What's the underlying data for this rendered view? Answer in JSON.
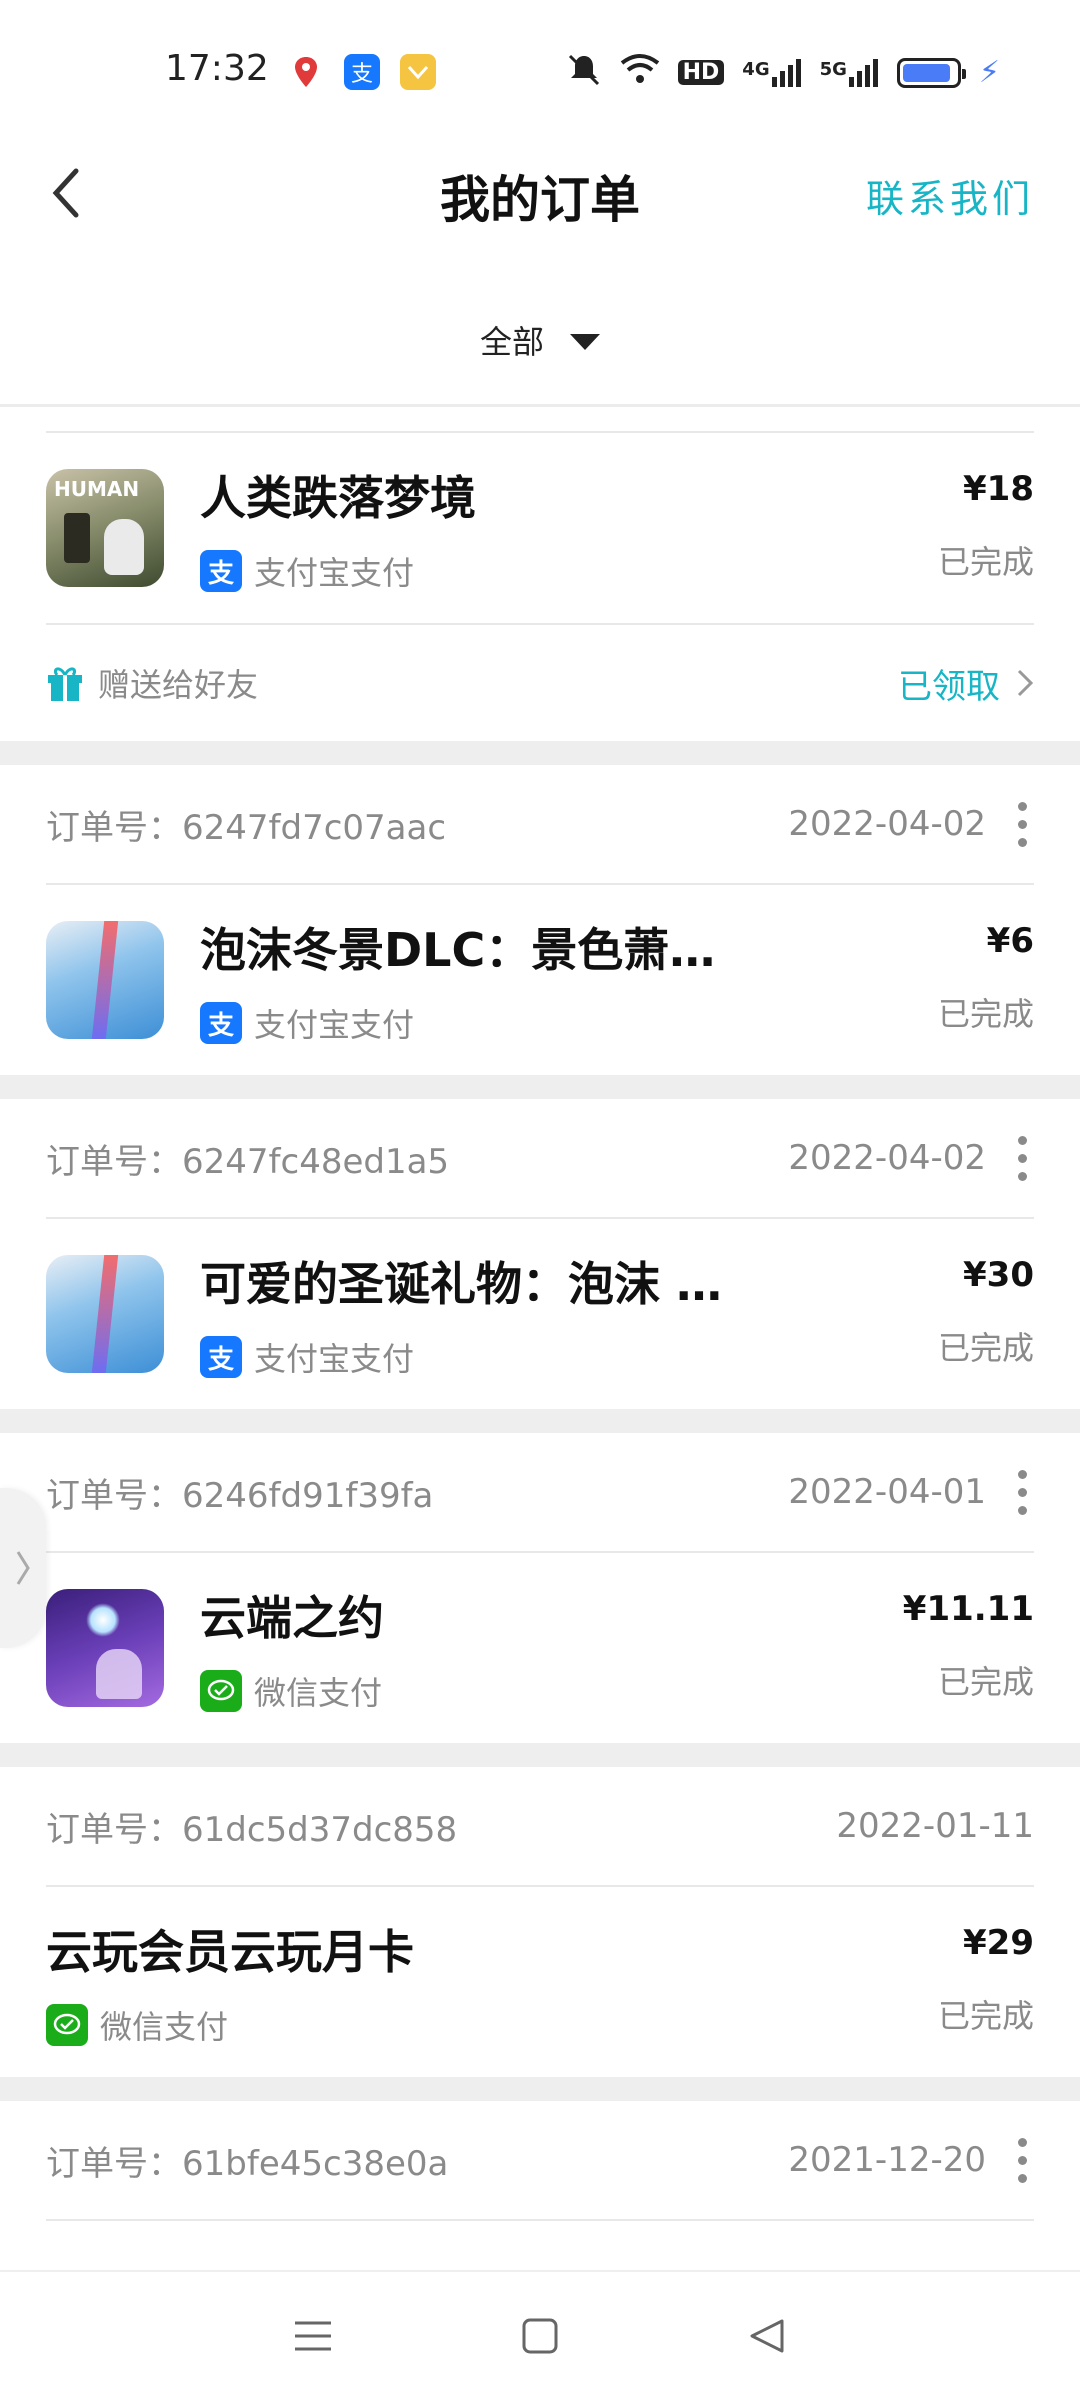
{
  "status_bar": {
    "time": "17:32",
    "network_1": "4G",
    "network_2": "5G",
    "hd": "HD",
    "battery_level": 0.9,
    "icons": [
      "location-pin-icon",
      "alipay-icon",
      "wallet-icon",
      "mute-icon",
      "wifi-icon",
      "hd-icon",
      "signal-4g-icon",
      "signal-5g-icon",
      "battery-icon",
      "charging-icon"
    ]
  },
  "header": {
    "title": "我的订单",
    "contact_label": "联系我们"
  },
  "filter": {
    "selected": "全部"
  },
  "colors": {
    "accent": "#17b5c5",
    "alipay": "#1677ff",
    "wechat": "#1aad19"
  },
  "orders": [
    {
      "name": "人类跌落梦境",
      "payment": "支付宝支付",
      "payment_icon": "alipay-icon",
      "price": "¥18",
      "status": "已完成",
      "gift_label": "赠送给好友",
      "gift_status": "已领取"
    },
    {
      "order_label": "订单号：",
      "order_id": "6247fd7c07aac",
      "date": "2022-04-02",
      "name": "泡沫冬景DLC：景色萧然 …",
      "payment": "支付宝支付",
      "payment_icon": "alipay-icon",
      "price": "¥6",
      "status": "已完成"
    },
    {
      "order_label": "订单号：",
      "order_id": "6247fc48ed1a5",
      "date": "2022-04-02",
      "name": "可爱的圣诞礼物：泡沫 …",
      "payment": "支付宝支付",
      "payment_icon": "alipay-icon",
      "price": "¥30",
      "status": "已完成"
    },
    {
      "order_label": "订单号：",
      "order_id": "6246fd91f39fa",
      "date": "2022-04-01",
      "name": "云端之约",
      "payment": "微信支付",
      "payment_icon": "wechat-pay-icon",
      "price": "¥11.11",
      "status": "已完成"
    },
    {
      "order_label": "订单号：",
      "order_id": "61dc5d37dc858",
      "date": "2022-01-11",
      "name": "云玩会员云玩月卡",
      "payment": "微信支付",
      "payment_icon": "wechat-pay-icon",
      "price": "¥29",
      "status": "已完成"
    },
    {
      "order_label": "订单号：",
      "order_id": "61bfe45c38e0a",
      "date": "2021-12-20"
    }
  ],
  "nav_bar": [
    "menu-icon",
    "home-square-icon",
    "back-triangle-icon"
  ]
}
